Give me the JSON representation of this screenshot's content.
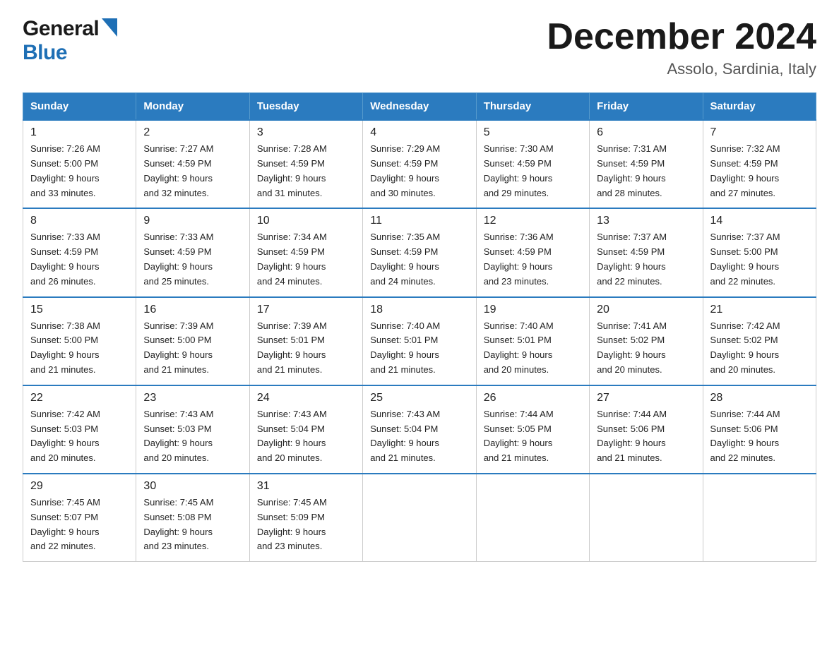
{
  "header": {
    "logo_general": "General",
    "logo_blue": "Blue",
    "month_title": "December 2024",
    "location": "Assolo, Sardinia, Italy"
  },
  "days_of_week": [
    "Sunday",
    "Monday",
    "Tuesday",
    "Wednesday",
    "Thursday",
    "Friday",
    "Saturday"
  ],
  "weeks": [
    [
      {
        "day": "1",
        "sunrise": "7:26 AM",
        "sunset": "5:00 PM",
        "daylight": "9 hours and 33 minutes."
      },
      {
        "day": "2",
        "sunrise": "7:27 AM",
        "sunset": "4:59 PM",
        "daylight": "9 hours and 32 minutes."
      },
      {
        "day": "3",
        "sunrise": "7:28 AM",
        "sunset": "4:59 PM",
        "daylight": "9 hours and 31 minutes."
      },
      {
        "day": "4",
        "sunrise": "7:29 AM",
        "sunset": "4:59 PM",
        "daylight": "9 hours and 30 minutes."
      },
      {
        "day": "5",
        "sunrise": "7:30 AM",
        "sunset": "4:59 PM",
        "daylight": "9 hours and 29 minutes."
      },
      {
        "day": "6",
        "sunrise": "7:31 AM",
        "sunset": "4:59 PM",
        "daylight": "9 hours and 28 minutes."
      },
      {
        "day": "7",
        "sunrise": "7:32 AM",
        "sunset": "4:59 PM",
        "daylight": "9 hours and 27 minutes."
      }
    ],
    [
      {
        "day": "8",
        "sunrise": "7:33 AM",
        "sunset": "4:59 PM",
        "daylight": "9 hours and 26 minutes."
      },
      {
        "day": "9",
        "sunrise": "7:33 AM",
        "sunset": "4:59 PM",
        "daylight": "9 hours and 25 minutes."
      },
      {
        "day": "10",
        "sunrise": "7:34 AM",
        "sunset": "4:59 PM",
        "daylight": "9 hours and 24 minutes."
      },
      {
        "day": "11",
        "sunrise": "7:35 AM",
        "sunset": "4:59 PM",
        "daylight": "9 hours and 24 minutes."
      },
      {
        "day": "12",
        "sunrise": "7:36 AM",
        "sunset": "4:59 PM",
        "daylight": "9 hours and 23 minutes."
      },
      {
        "day": "13",
        "sunrise": "7:37 AM",
        "sunset": "4:59 PM",
        "daylight": "9 hours and 22 minutes."
      },
      {
        "day": "14",
        "sunrise": "7:37 AM",
        "sunset": "5:00 PM",
        "daylight": "9 hours and 22 minutes."
      }
    ],
    [
      {
        "day": "15",
        "sunrise": "7:38 AM",
        "sunset": "5:00 PM",
        "daylight": "9 hours and 21 minutes."
      },
      {
        "day": "16",
        "sunrise": "7:39 AM",
        "sunset": "5:00 PM",
        "daylight": "9 hours and 21 minutes."
      },
      {
        "day": "17",
        "sunrise": "7:39 AM",
        "sunset": "5:01 PM",
        "daylight": "9 hours and 21 minutes."
      },
      {
        "day": "18",
        "sunrise": "7:40 AM",
        "sunset": "5:01 PM",
        "daylight": "9 hours and 21 minutes."
      },
      {
        "day": "19",
        "sunrise": "7:40 AM",
        "sunset": "5:01 PM",
        "daylight": "9 hours and 20 minutes."
      },
      {
        "day": "20",
        "sunrise": "7:41 AM",
        "sunset": "5:02 PM",
        "daylight": "9 hours and 20 minutes."
      },
      {
        "day": "21",
        "sunrise": "7:42 AM",
        "sunset": "5:02 PM",
        "daylight": "9 hours and 20 minutes."
      }
    ],
    [
      {
        "day": "22",
        "sunrise": "7:42 AM",
        "sunset": "5:03 PM",
        "daylight": "9 hours and 20 minutes."
      },
      {
        "day": "23",
        "sunrise": "7:43 AM",
        "sunset": "5:03 PM",
        "daylight": "9 hours and 20 minutes."
      },
      {
        "day": "24",
        "sunrise": "7:43 AM",
        "sunset": "5:04 PM",
        "daylight": "9 hours and 20 minutes."
      },
      {
        "day": "25",
        "sunrise": "7:43 AM",
        "sunset": "5:04 PM",
        "daylight": "9 hours and 21 minutes."
      },
      {
        "day": "26",
        "sunrise": "7:44 AM",
        "sunset": "5:05 PM",
        "daylight": "9 hours and 21 minutes."
      },
      {
        "day": "27",
        "sunrise": "7:44 AM",
        "sunset": "5:06 PM",
        "daylight": "9 hours and 21 minutes."
      },
      {
        "day": "28",
        "sunrise": "7:44 AM",
        "sunset": "5:06 PM",
        "daylight": "9 hours and 22 minutes."
      }
    ],
    [
      {
        "day": "29",
        "sunrise": "7:45 AM",
        "sunset": "5:07 PM",
        "daylight": "9 hours and 22 minutes."
      },
      {
        "day": "30",
        "sunrise": "7:45 AM",
        "sunset": "5:08 PM",
        "daylight": "9 hours and 23 minutes."
      },
      {
        "day": "31",
        "sunrise": "7:45 AM",
        "sunset": "5:09 PM",
        "daylight": "9 hours and 23 minutes."
      },
      null,
      null,
      null,
      null
    ]
  ],
  "labels": {
    "sunrise": "Sunrise:",
    "sunset": "Sunset:",
    "daylight": "Daylight:"
  }
}
